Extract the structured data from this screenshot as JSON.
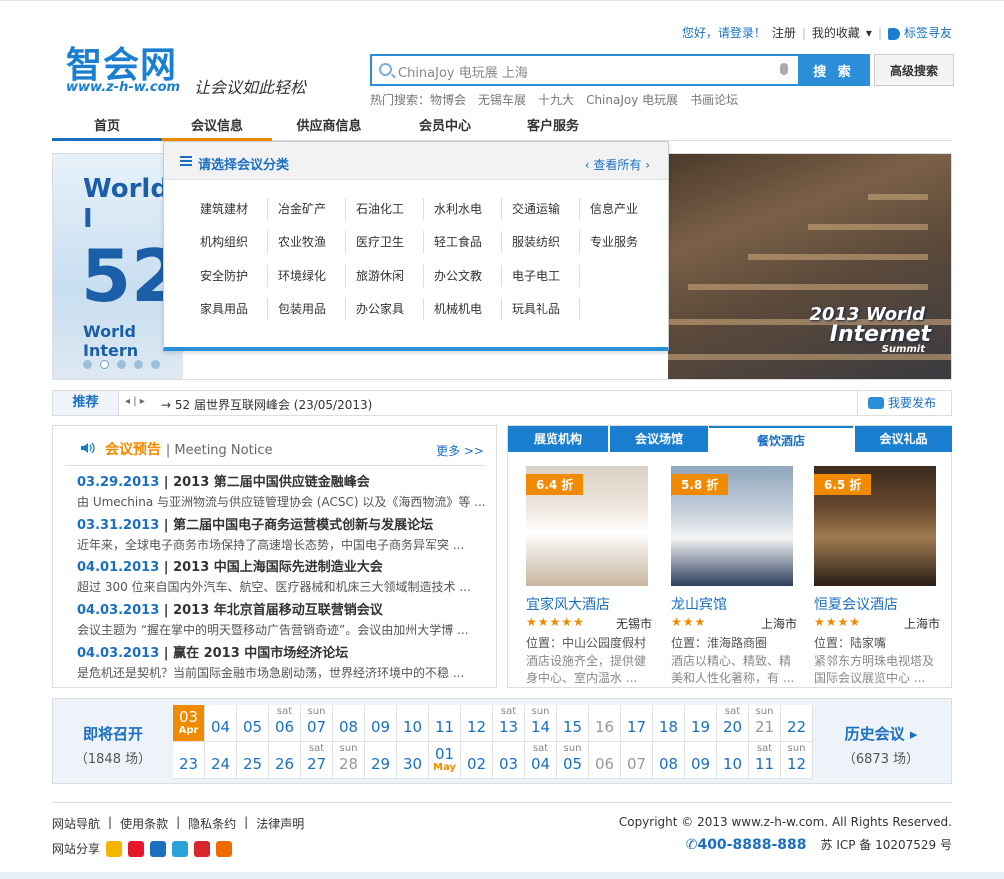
{
  "brand": {
    "logo_text": "智会网",
    "url": "www.z-h-w.com",
    "slogan": "让会议如此轻松"
  },
  "top_links": {
    "login_prompt": "您好，请登录！",
    "register": "注册",
    "favorites": "我的收藏",
    "bookmark": "标签寻友"
  },
  "search": {
    "value": "ChinaJoy 电玩展 上海",
    "button": "搜 索",
    "advanced": "高级搜索",
    "hot_label": "热门搜索：",
    "hot_items": [
      "物博会",
      "无锡车展",
      "十九大",
      "ChinaJoy 电玩展",
      "书画论坛"
    ]
  },
  "nav": [
    "首页",
    "会议信息",
    "供应商信息",
    "会员中心",
    "客户服务"
  ],
  "banner": {
    "left_title": "World I",
    "left_number": "52",
    "left_sub": "World Intern",
    "right_line1": "2013 World",
    "right_line2": "Internet",
    "right_line3": "Summit"
  },
  "category_dropdown": {
    "title": "请选择会议分类",
    "view_all": "查看所有",
    "rows": [
      [
        "建筑建材",
        "冶金矿产",
        "石油化工",
        "水利水电",
        "交通运输",
        "信息产业"
      ],
      [
        "机构组织",
        "农业牧渔",
        "医疗卫生",
        "轻工食品",
        "服装纺织",
        "专业服务"
      ],
      [
        "安全防护",
        "环境绿化",
        "旅游休闲",
        "办公文教",
        "电子电工"
      ],
      [
        "家具用品",
        "包装用品",
        "办公家具",
        "机械机电",
        "玩具礼品"
      ]
    ]
  },
  "recommend": {
    "label": "推荐",
    "arrows": "◂ | ▸",
    "item": "→  52 届世界互联网峰会 (23/05/2013)",
    "publish": "我要发布"
  },
  "notice": {
    "title": "会议预告",
    "title_en": "Meeting Notice",
    "more": "更多 >>",
    "items": [
      {
        "date": "03.29.2013",
        "title": "2013 第二届中国供应链金融峰会",
        "desc": "由 Umechina 与亚洲物流与供应链管理协会 (ACSC) 以及《海西物流》等 ..."
      },
      {
        "date": "03.31.2013",
        "title": "第二届中国电子商务运营模式创新与发展论坛",
        "desc": "近年来，全球电子商务市场保持了高速增长态势，中国电子商务异军突 ..."
      },
      {
        "date": "04.01.2013",
        "title": "2013 中国上海国际先进制造业大会",
        "desc": "超过 300 位来自国内外汽车、航空、医疗器械和机床三大领域制造技术 ..."
      },
      {
        "date": "04.03.2013",
        "title": "2013 年北京首届移动互联营销会议",
        "desc": "会议主题为 “握在掌中的明天暨移动广告营销奇迹”。会议由加州大学博 ..."
      },
      {
        "date": "04.03.2013",
        "title": "赢在 2013 中国市场经济论坛",
        "desc": "是危机还是契机？当前国际金融市场急剧动荡，世界经济环境中的不稳 ..."
      }
    ]
  },
  "venue_tabs": [
    "展览机构",
    "会议场馆",
    "餐饮酒店",
    "会议礼品"
  ],
  "hotels": [
    {
      "discount": "6.4 折",
      "name": "宜家风大酒店",
      "stars": "★★★★★",
      "city": "无锡市",
      "location": "位置：中山公园度假村",
      "desc": "酒店设施齐全，提供健身中心、室内温水 ..."
    },
    {
      "discount": "5.8 折",
      "name": "龙山宾馆",
      "stars": "★★★",
      "city": "上海市",
      "location": "位置：淮海路商圈",
      "desc": "酒店以精心、精致、精美和人性化著称，有 ..."
    },
    {
      "discount": "6.5 折",
      "name": "恒夏会议酒店",
      "stars": "★★★★",
      "city": "上海市",
      "location": "位置：陆家嘴",
      "desc": "紧邻东方明珠电视塔及国际会议展览中心 ..."
    }
  ],
  "calendar": {
    "upcoming_title": "即将召开",
    "upcoming_count": "（1848 场）",
    "history_title": "历史会议",
    "history_count": "（6873 场）",
    "row1": [
      {
        "d": "03",
        "m": "Apr",
        "today": true
      },
      {
        "d": "04"
      },
      {
        "d": "05"
      },
      {
        "d": "06",
        "w": "sat"
      },
      {
        "d": "07",
        "w": "sun"
      },
      {
        "d": "08"
      },
      {
        "d": "09"
      },
      {
        "d": "10"
      },
      {
        "d": "11"
      },
      {
        "d": "12"
      },
      {
        "d": "13",
        "w": "sat"
      },
      {
        "d": "14",
        "w": "sun"
      },
      {
        "d": "15"
      },
      {
        "d": "16",
        "grey": true
      },
      {
        "d": "17"
      },
      {
        "d": "18"
      },
      {
        "d": "19"
      },
      {
        "d": "20",
        "w": "sat"
      },
      {
        "d": "21",
        "w": "sun",
        "grey": true
      },
      {
        "d": "22"
      }
    ],
    "row2": [
      {
        "d": "23"
      },
      {
        "d": "24"
      },
      {
        "d": "25"
      },
      {
        "d": "26"
      },
      {
        "d": "27",
        "w": "sat"
      },
      {
        "d": "28",
        "w": "sun",
        "grey": true
      },
      {
        "d": "29"
      },
      {
        "d": "30"
      },
      {
        "d": "01",
        "m": "May"
      },
      {
        "d": "02"
      },
      {
        "d": "03"
      },
      {
        "d": "04",
        "w": "sat"
      },
      {
        "d": "05",
        "w": "sun"
      },
      {
        "d": "06",
        "grey": true
      },
      {
        "d": "07",
        "grey": true
      },
      {
        "d": "08"
      },
      {
        "d": "09"
      },
      {
        "d": "10"
      },
      {
        "d": "11",
        "w": "sat"
      },
      {
        "d": "12",
        "w": "sun"
      }
    ]
  },
  "footer": {
    "links": [
      "网站导航",
      "使用条款",
      "隐私条约",
      "法律声明"
    ],
    "share_label": "网站分享",
    "copyright": "Copyright © 2013 www.z-h-w.com. All Rights Reserved.",
    "tel": "400-8888-888",
    "icp": "苏 ICP 备 10207529 号"
  },
  "colors": {
    "brand_blue": "#1a7fd0",
    "accent_orange": "#f08a00"
  }
}
